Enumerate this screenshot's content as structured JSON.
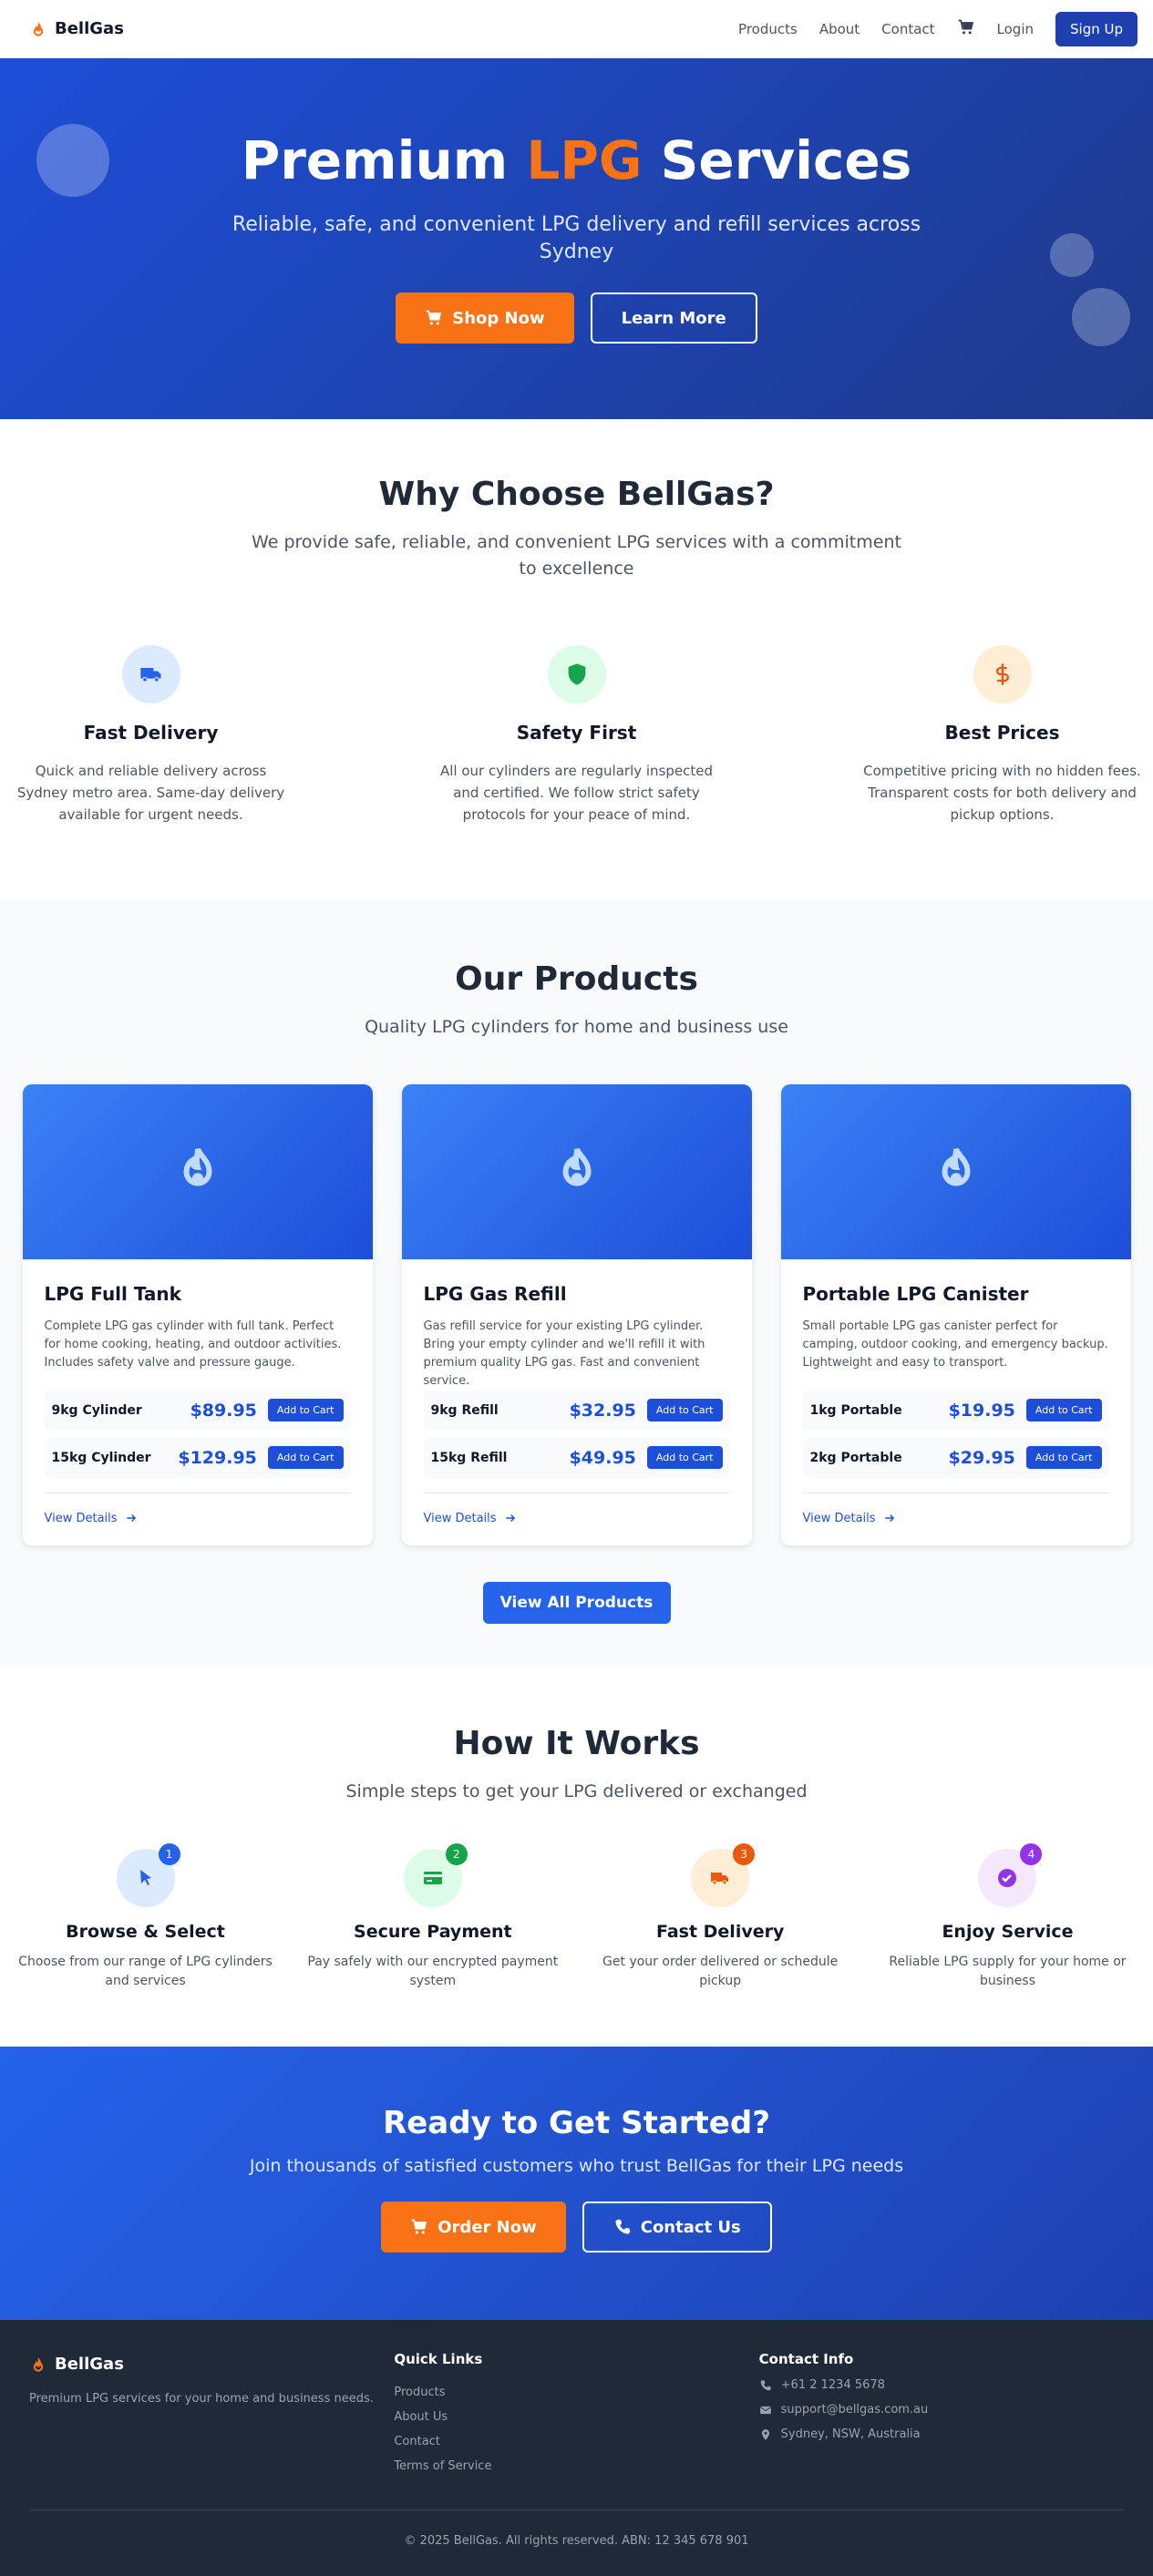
{
  "brand": {
    "name": "BellGas"
  },
  "nav": {
    "links": [
      "Products",
      "About",
      "Contact"
    ],
    "login": "Login",
    "signup": "Sign Up"
  },
  "hero": {
    "title_pre": "Premium ",
    "title_accent": "LPG",
    "title_post": " Services",
    "subtitle": "Reliable, safe, and convenient LPG delivery and refill services across Sydney",
    "shop_now": "Shop Now",
    "learn_more": "Learn More"
  },
  "why": {
    "title": "Why Choose BellGas?",
    "subtitle": "We provide safe, reliable, and convenient LPG services with a commitment to excellence",
    "features": [
      {
        "icon": "truck-icon",
        "title": "Fast Delivery",
        "text": "Quick and reliable delivery across Sydney metro area. Same-day delivery available for urgent needs."
      },
      {
        "icon": "shield-icon",
        "title": "Safety First",
        "text": "All our cylinders are regularly inspected and certified. We follow strict safety protocols for your peace of mind."
      },
      {
        "icon": "dollar-icon",
        "title": "Best Prices",
        "text": "Competitive pricing with no hidden fees. Transparent costs for both delivery and pickup options."
      }
    ]
  },
  "products": {
    "title": "Our Products",
    "subtitle": "Quality LPG cylinders for home and business use",
    "add_label": "Add to Cart",
    "details_label": "View Details",
    "view_all": "View All Products",
    "items": [
      {
        "name": "LPG Full Tank",
        "desc": "Complete LPG gas cylinder with full tank. Perfect for home cooking, heating, and outdoor activities. Includes safety valve and pressure gauge.",
        "options": [
          {
            "name": "9kg Cylinder",
            "price": "$89.95"
          },
          {
            "name": "15kg Cylinder",
            "price": "$129.95"
          }
        ]
      },
      {
        "name": "LPG Gas Refill",
        "desc": "Gas refill service for your existing LPG cylinder. Bring your empty cylinder and we'll refill it with premium quality LPG gas. Fast and convenient service.",
        "options": [
          {
            "name": "9kg Refill",
            "price": "$32.95"
          },
          {
            "name": "15kg Refill",
            "price": "$49.95"
          }
        ]
      },
      {
        "name": "Portable LPG Canister",
        "desc": "Small portable LPG gas canister perfect for camping, outdoor cooking, and emergency backup. Lightweight and easy to transport.",
        "options": [
          {
            "name": "1kg Portable",
            "price": "$19.95"
          },
          {
            "name": "2kg Portable",
            "price": "$29.95"
          }
        ]
      }
    ]
  },
  "how": {
    "title": "How It Works",
    "subtitle": "Simple steps to get your LPG delivered or exchanged",
    "steps": [
      {
        "num": "1",
        "title": "Browse & Select",
        "text": "Choose from our range of LPG cylinders and services"
      },
      {
        "num": "2",
        "title": "Secure Payment",
        "text": "Pay safely with our encrypted payment system"
      },
      {
        "num": "3",
        "title": "Fast Delivery",
        "text": "Get your order delivered or schedule pickup"
      },
      {
        "num": "4",
        "title": "Enjoy Service",
        "text": "Reliable LPG supply for your home or business"
      }
    ]
  },
  "cta": {
    "title": "Ready to Get Started?",
    "subtitle": "Join thousands of satisfied customers who trust BellGas for their LPG needs",
    "order_now": "Order Now",
    "contact_us": "Contact Us"
  },
  "footer": {
    "tagline": "Premium LPG services for your home and business needs.",
    "quick_links_title": "Quick Links",
    "quick_links": [
      "Products",
      "About Us",
      "Contact",
      "Terms of Service"
    ],
    "contact_title": "Contact Info",
    "phone": "+61 2 1234 5678",
    "email": "support@bellgas.com.au",
    "location": "Sydney, NSW, Australia",
    "copyright": "© 2025 BellGas. All rights reserved. ABN: 12 345 678 901"
  },
  "colors": {
    "primary": "#1d4ed8",
    "accent": "#f97316",
    "footer_bg": "#1f2937"
  }
}
